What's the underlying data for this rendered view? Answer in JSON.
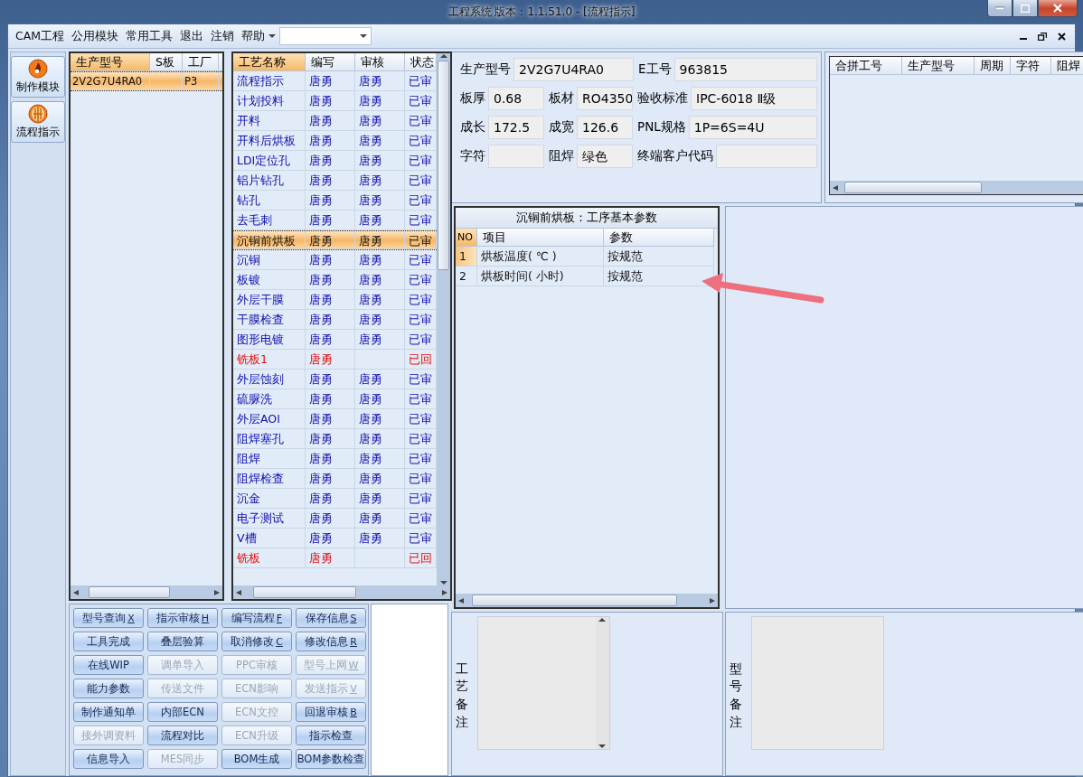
{
  "window": {
    "title": "工程系统   版本：1.1.51.0 - [流程指示]"
  },
  "menu": {
    "items": [
      "CAM工程",
      "公用模块",
      "常用工具",
      "退出",
      "注销",
      "帮助"
    ]
  },
  "nav": [
    {
      "label": "制作模块",
      "kind": "flame"
    },
    {
      "label": "流程指示",
      "kind": "stripes"
    }
  ],
  "model_grid": {
    "columns": [
      {
        "label": "生产型号",
        "sorted": true
      },
      {
        "label": "S板",
        "sorted": false
      },
      {
        "label": "工厂",
        "sorted": false
      }
    ],
    "rows": [
      {
        "cells": [
          "2V2G7U4RA0",
          "",
          "P3"
        ],
        "selected": true
      }
    ]
  },
  "process_grid": {
    "columns": [
      {
        "label": "工艺名称",
        "sorted": true
      },
      {
        "label": "编写",
        "sorted": false
      },
      {
        "label": "审核",
        "sorted": false
      },
      {
        "label": "状态",
        "sorted": false
      }
    ],
    "rows": [
      {
        "name": "流程指示",
        "writer": "唐勇",
        "reviewer": "唐勇",
        "status": "已审",
        "returned": false,
        "selected": false
      },
      {
        "name": "计划投料",
        "writer": "唐勇",
        "reviewer": "唐勇",
        "status": "已审",
        "returned": false,
        "selected": false
      },
      {
        "name": "开料",
        "writer": "唐勇",
        "reviewer": "唐勇",
        "status": "已审",
        "returned": false,
        "selected": false
      },
      {
        "name": "开料后烘板",
        "writer": "唐勇",
        "reviewer": "唐勇",
        "status": "已审",
        "returned": false,
        "selected": false
      },
      {
        "name": "LDI定位孔",
        "writer": "唐勇",
        "reviewer": "唐勇",
        "status": "已审",
        "returned": false,
        "selected": false
      },
      {
        "name": "铝片钻孔",
        "writer": "唐勇",
        "reviewer": "唐勇",
        "status": "已审",
        "returned": false,
        "selected": false
      },
      {
        "name": "钻孔",
        "writer": "唐勇",
        "reviewer": "唐勇",
        "status": "已审",
        "returned": false,
        "selected": false
      },
      {
        "name": "去毛刺",
        "writer": "唐勇",
        "reviewer": "唐勇",
        "status": "已审",
        "returned": false,
        "selected": false
      },
      {
        "name": "沉铜前烘板",
        "writer": "唐勇",
        "reviewer": "唐勇",
        "status": "已审",
        "returned": false,
        "selected": true
      },
      {
        "name": "沉铜",
        "writer": "唐勇",
        "reviewer": "唐勇",
        "status": "已审",
        "returned": false,
        "selected": false
      },
      {
        "name": "板镀",
        "writer": "唐勇",
        "reviewer": "唐勇",
        "status": "已审",
        "returned": false,
        "selected": false
      },
      {
        "name": "外层干膜",
        "writer": "唐勇",
        "reviewer": "唐勇",
        "status": "已审",
        "returned": false,
        "selected": false
      },
      {
        "name": "干膜检查",
        "writer": "唐勇",
        "reviewer": "唐勇",
        "status": "已审",
        "returned": false,
        "selected": false
      },
      {
        "name": "图形电镀",
        "writer": "唐勇",
        "reviewer": "唐勇",
        "status": "已审",
        "returned": false,
        "selected": false
      },
      {
        "name": "铣板1",
        "writer": "唐勇",
        "status": "已回",
        "returned": true,
        "selected": false
      },
      {
        "name": "外层蚀刻",
        "writer": "唐勇",
        "reviewer": "唐勇",
        "status": "已审",
        "returned": false,
        "selected": false
      },
      {
        "name": "硫脲洗",
        "writer": "唐勇",
        "reviewer": "唐勇",
        "status": "已审",
        "returned": false,
        "selected": false
      },
      {
        "name": "外层AOI",
        "writer": "唐勇",
        "reviewer": "唐勇",
        "status": "已审",
        "returned": false,
        "selected": false
      },
      {
        "name": "阻焊塞孔",
        "writer": "唐勇",
        "reviewer": "唐勇",
        "status": "已审",
        "returned": false,
        "selected": false
      },
      {
        "name": "阻焊",
        "writer": "唐勇",
        "reviewer": "唐勇",
        "status": "已审",
        "returned": false,
        "selected": false
      },
      {
        "name": "阻焊检查",
        "writer": "唐勇",
        "reviewer": "唐勇",
        "status": "已审",
        "returned": false,
        "selected": false
      },
      {
        "name": "沉金",
        "writer": "唐勇",
        "reviewer": "唐勇",
        "status": "已审",
        "returned": false,
        "selected": false
      },
      {
        "name": "电子测试",
        "writer": "唐勇",
        "reviewer": "唐勇",
        "status": "已审",
        "returned": false,
        "selected": false
      },
      {
        "name": "V槽",
        "writer": "唐勇",
        "reviewer": "唐勇",
        "status": "已审",
        "returned": false,
        "selected": false
      },
      {
        "name": "铣板",
        "writer": "唐勇",
        "status": "已回",
        "returned": true,
        "selected": false
      }
    ]
  },
  "actions": [
    {
      "label": "型号查询",
      "shortcut": "X",
      "disabled": false
    },
    {
      "label": "指示审核",
      "shortcut": "H",
      "disabled": false
    },
    {
      "label": "编写流程",
      "shortcut": "F",
      "disabled": false
    },
    {
      "label": "保存信息",
      "shortcut": "S",
      "disabled": false
    },
    {
      "label": "工具完成",
      "disabled": false
    },
    {
      "label": "叠层验算",
      "disabled": false
    },
    {
      "label": "取消修改",
      "shortcut": "C",
      "disabled": false
    },
    {
      "label": "修改信息",
      "shortcut": "R",
      "disabled": false
    },
    {
      "label": "在线WIP",
      "disabled": false
    },
    {
      "label": "调单导入",
      "disabled": true
    },
    {
      "label": "PPC审核",
      "disabled": true
    },
    {
      "label": "型号上网",
      "shortcut": "W",
      "disabled": true
    },
    {
      "label": "能力参数",
      "disabled": false
    },
    {
      "label": "传送文件",
      "disabled": true
    },
    {
      "label": "ECN影响",
      "disabled": true
    },
    {
      "label": "发送指示",
      "shortcut": "V",
      "disabled": true
    },
    {
      "label": "制作通知单",
      "disabled": false
    },
    {
      "label": "内部ECN",
      "disabled": false
    },
    {
      "label": "ECN文控",
      "disabled": true
    },
    {
      "label": "回退审核",
      "shortcut": "B",
      "disabled": false
    },
    {
      "label": "接外调资料",
      "disabled": true
    },
    {
      "label": "流程对比",
      "disabled": false
    },
    {
      "label": "ECN升级",
      "disabled": true
    },
    {
      "label": "指示检查",
      "disabled": false
    },
    {
      "label": "信息导入",
      "disabled": false
    },
    {
      "label": "MES同步",
      "disabled": true
    },
    {
      "label": "BOM生成",
      "disabled": false
    },
    {
      "label": "BOM参数检查",
      "disabled": false
    }
  ],
  "info_form": [
    [
      {
        "label": "生产型号",
        "value": "2V2G7U4RA0"
      },
      {
        "label": "E工号",
        "value": "963815"
      }
    ],
    [
      {
        "label": "板厚",
        "value": "0.68"
      },
      {
        "label": "板材",
        "value": "RO4350"
      },
      {
        "label": "验收标准",
        "value": "IPC-6018 Ⅱ级"
      }
    ],
    [
      {
        "label": "成长",
        "value": "172.5"
      },
      {
        "label": "成宽",
        "value": "126.6"
      },
      {
        "label": "PNL规格",
        "value": "1P=6S=4U"
      }
    ],
    [
      {
        "label": "字符"
      },
      {
        "label": "阻焊",
        "value": "绿色"
      },
      {
        "label": "终端客户代码"
      }
    ]
  ],
  "merge_grid": {
    "columns": [
      "合拼工号",
      "生产型号",
      "周期",
      "字符",
      "阻焊"
    ]
  },
  "params": {
    "title": "沉铜前烘板：工序基本参数",
    "columns": [
      "NO",
      "项目",
      "参数"
    ],
    "rows": [
      {
        "no": "1",
        "item": "烘板温度( ℃ )",
        "value": "按规范",
        "selected": true
      },
      {
        "no": "2",
        "item": "烘板时间( 小时)",
        "value": "按规范",
        "selected": false
      }
    ]
  },
  "notes": [
    {
      "label": "工艺备注"
    },
    {
      "label": "型号备注"
    }
  ]
}
